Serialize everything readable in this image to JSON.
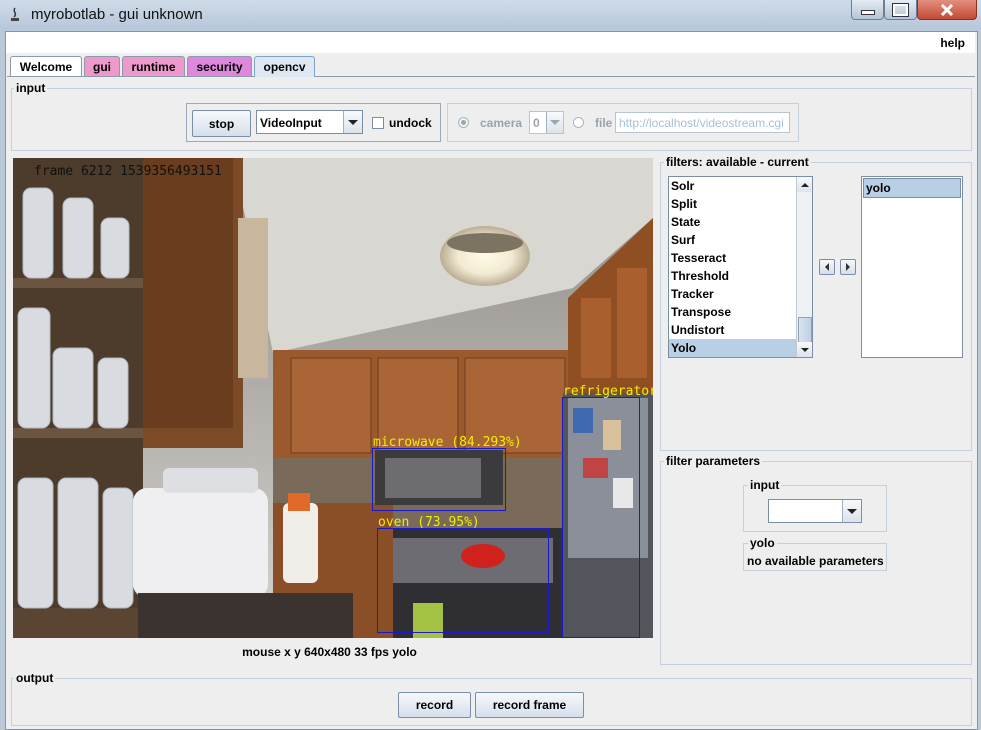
{
  "window": {
    "title": "myrobotlab - gui unknown",
    "minimize_icon": "minimize-icon",
    "maximize_icon": "maximize-icon",
    "close_icon": "close-icon"
  },
  "menubar": {
    "help": "help"
  },
  "tabs": [
    {
      "label": "Welcome",
      "color": "#ffffff"
    },
    {
      "label": "gui",
      "color": "#ee99cc"
    },
    {
      "label": "runtime",
      "color": "#ee99cc"
    },
    {
      "label": "security",
      "color": "#dd88dd"
    },
    {
      "label": "opencv",
      "color": "#dde8f3",
      "selected": true
    }
  ],
  "input": {
    "legend": "input",
    "stop_label": "stop",
    "source_value": "VideoInput",
    "undock_label": "undock",
    "camera_label": "camera",
    "camera_index": "0",
    "file_label": "file",
    "file_value": "http://localhost/videostream.cgi"
  },
  "video": {
    "overlay_text": "frame 6212 1539356493151",
    "detections": [
      {
        "label": "microwave (84.293%)"
      },
      {
        "label": "oven (73.95%)"
      },
      {
        "label": "refrigerator"
      }
    ],
    "status": "mouse x y  640x480  33 fps  yolo"
  },
  "filters": {
    "legend": "filters: available - current",
    "available": [
      "Solr",
      "Split",
      "State",
      "Surf",
      "Tesseract",
      "Threshold",
      "Tracker",
      "Transpose",
      "Undistort",
      "Yolo"
    ],
    "selected_available": "Yolo",
    "current": [
      "yolo"
    ]
  },
  "filter_parameters": {
    "legend": "filter parameters",
    "input_legend": "input",
    "input_value": "",
    "yolo_legend": "yolo",
    "yolo_text": "no available parameters"
  },
  "output": {
    "legend": "output",
    "record_label": "record",
    "record_frame_label": "record frame"
  },
  "colors": {
    "accent_selection": "#b8cfe5",
    "detection_box": "#1a1acc",
    "detection_text": "#f0f000"
  }
}
